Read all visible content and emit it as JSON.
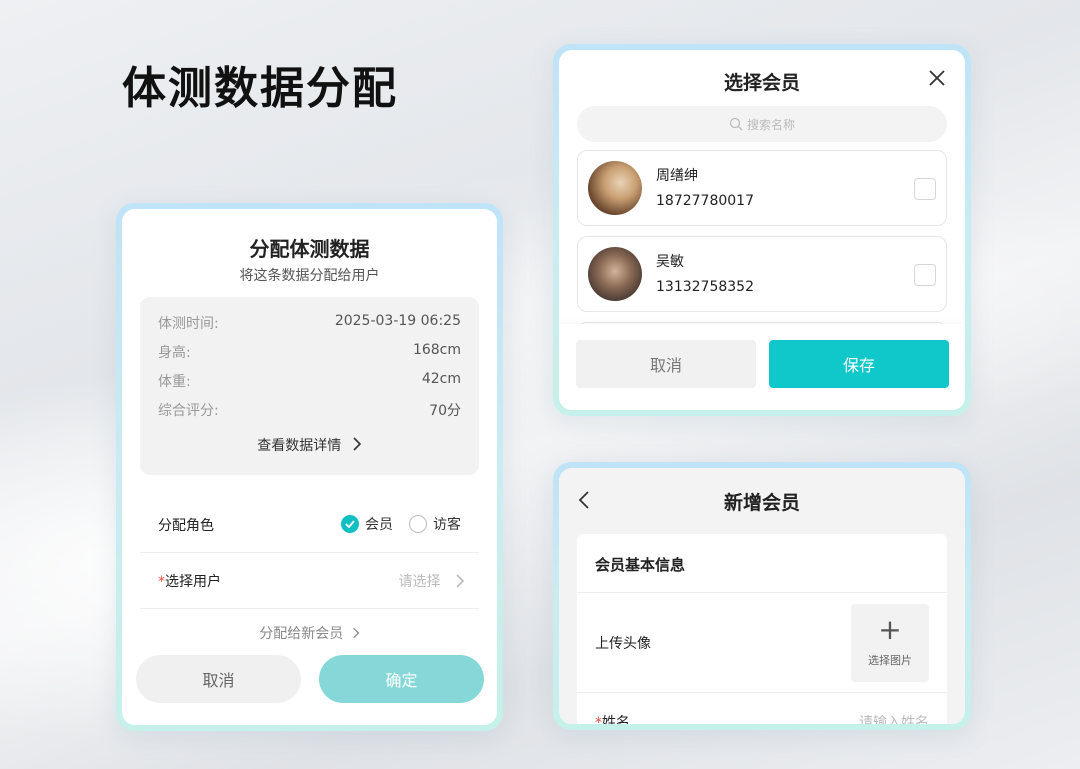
{
  "headline": "体测数据分配",
  "assign_dialog": {
    "title": "分配体测数据",
    "subtitle": "将这条数据分配给用户",
    "info": [
      {
        "label": "体测时间:",
        "value": "2025-03-19 06:25"
      },
      {
        "label": "身高:",
        "value": "168cm"
      },
      {
        "label": "体重:",
        "value": "42cm"
      },
      {
        "label": "综合评分:",
        "value": "70分"
      }
    ],
    "detail_link": "查看数据详情",
    "role_label": "分配角色",
    "role_options": [
      "会员",
      "访客"
    ],
    "role_selected": "会员",
    "user_label": "选择用户",
    "user_placeholder": "请选择",
    "new_member_link": "分配给新会员",
    "cancel": "取消",
    "confirm": "确定"
  },
  "select_dialog": {
    "title": "选择会员",
    "search_placeholder": "搜索名称",
    "members": [
      {
        "name": "周缮绅",
        "phone": "18727780017"
      },
      {
        "name": "吴敏",
        "phone": "13132758352"
      }
    ],
    "cancel": "取消",
    "save": "保存"
  },
  "new_member": {
    "title": "新增会员",
    "section_title": "会员基本信息",
    "avatar_label": "上传头像",
    "upload_text": "选择图片",
    "name_label": "姓名",
    "name_placeholder": "请输入姓名"
  },
  "colors": {
    "accent": "#10bfc3",
    "accent_light": "#86d8d8",
    "required": "#e24b3b"
  }
}
